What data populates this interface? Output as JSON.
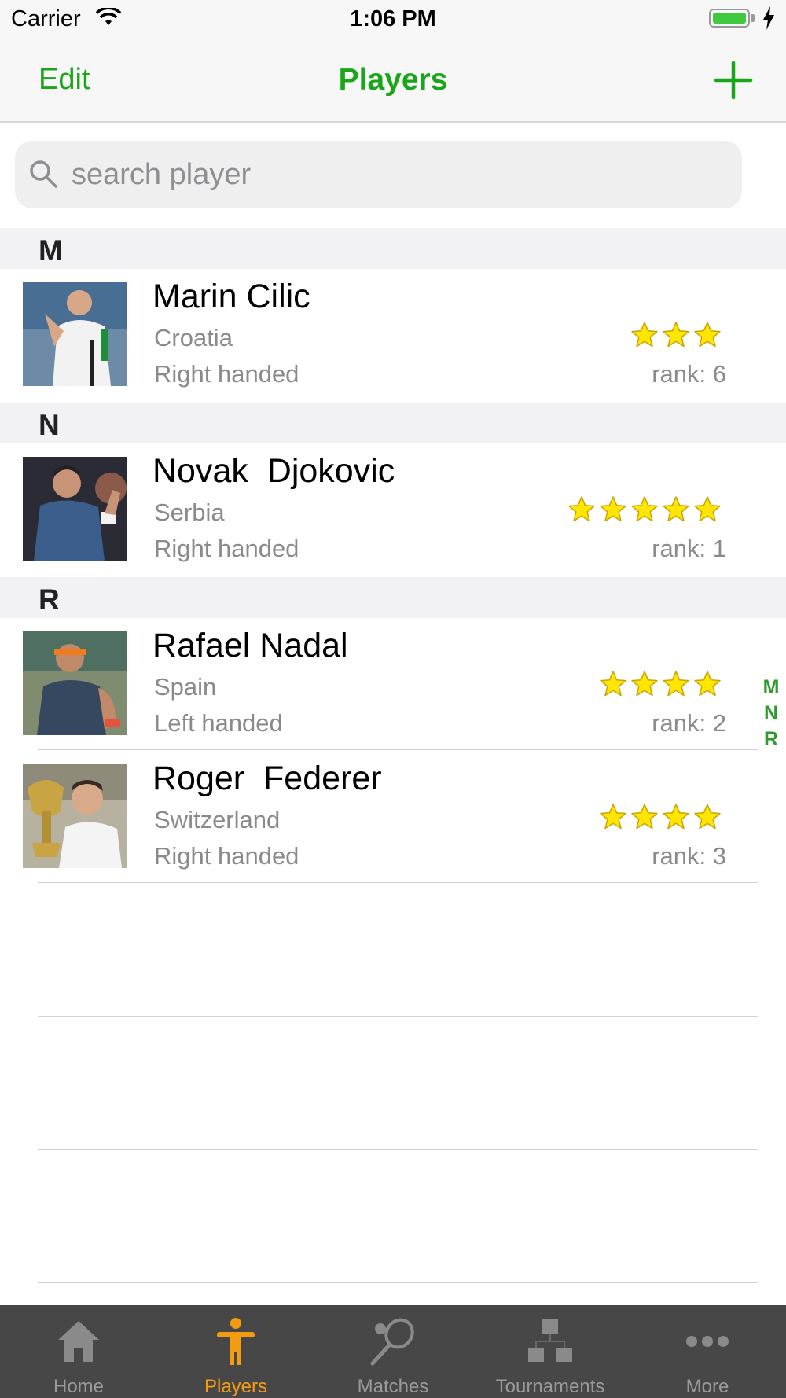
{
  "status_bar": {
    "carrier": "Carrier",
    "time": "1:06 PM"
  },
  "nav": {
    "edit_label": "Edit",
    "title": "Players",
    "add_icon": "plus-icon"
  },
  "search": {
    "placeholder": "search player",
    "value": ""
  },
  "colors": {
    "accent": "#1aa51a",
    "tab_active": "#f39c12",
    "tab_bar": "#474747",
    "star": "#ffe600"
  },
  "sections": [
    {
      "letter": "M",
      "players": [
        {
          "name": "Marin Cilic",
          "country": "Croatia",
          "hand": "Right handed",
          "stars": 3,
          "rank": "rank: 6"
        }
      ]
    },
    {
      "letter": "N",
      "players": [
        {
          "name": "Novak  Djokovic",
          "country": "Serbia",
          "hand": "Right handed",
          "stars": 5,
          "rank": "rank: 1"
        }
      ]
    },
    {
      "letter": "R",
      "players": [
        {
          "name": "Rafael Nadal",
          "country": "Spain",
          "hand": "Left handed",
          "stars": 4,
          "rank": "rank: 2"
        },
        {
          "name": "Roger  Federer",
          "country": "Switzerland",
          "hand": "Right handed",
          "stars": 4,
          "rank": "rank: 3"
        }
      ]
    }
  ],
  "index": [
    "M",
    "N",
    "R"
  ],
  "tabs": [
    {
      "label": "Home",
      "icon": "house-icon",
      "active": false
    },
    {
      "label": "Players",
      "icon": "person-icon",
      "active": true
    },
    {
      "label": "Matches",
      "icon": "tennis-racket-icon",
      "active": false
    },
    {
      "label": "Tournaments",
      "icon": "bracket-icon",
      "active": false
    },
    {
      "label": "More",
      "icon": "more-dots-icon",
      "active": false
    }
  ]
}
